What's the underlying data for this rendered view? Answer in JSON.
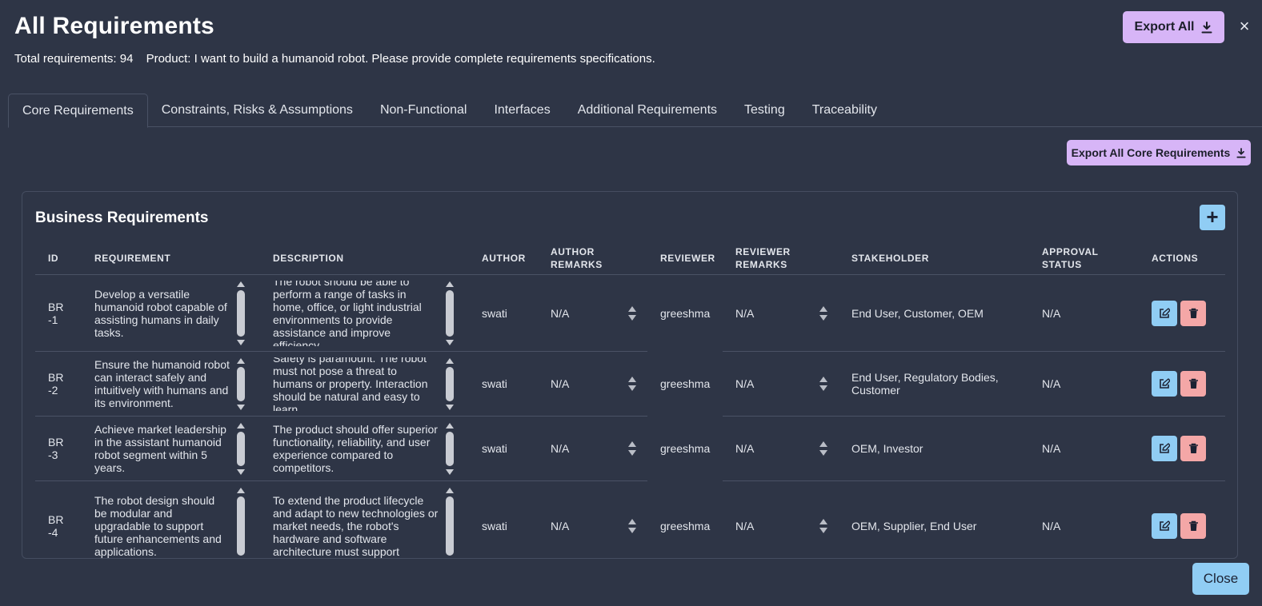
{
  "header": {
    "title": "All Requirements",
    "total_label": "Total requirements: 94",
    "product_label": "Product: I want to build a humanoid robot. Please provide complete requirements specifications.",
    "export_all_label": "Export All",
    "close_icon": "×"
  },
  "tabs": [
    {
      "label": "Core Requirements",
      "active": true
    },
    {
      "label": "Constraints, Risks & Assumptions"
    },
    {
      "label": "Non-Functional"
    },
    {
      "label": "Interfaces"
    },
    {
      "label": "Additional Requirements"
    },
    {
      "label": "Testing"
    },
    {
      "label": "Traceability"
    }
  ],
  "export_core_label": "Export All Core Requirements",
  "section": {
    "title": "Business Requirements",
    "add_icon": "+",
    "columns": [
      "ID",
      "REQUIREMENT",
      "DESCRIPTION",
      "AUTHOR",
      "AUTHOR REMARKS",
      "REVIEWER",
      "REVIEWER REMARKS",
      "STAKEHOLDER",
      "APPROVAL STATUS",
      "ACTIONS"
    ],
    "rows": [
      {
        "id": "BR-1",
        "requirement": "Develop a versatile humanoid robot capable of assisting humans in daily tasks.",
        "description": "The robot should be able to perform a range of tasks in home, office, or light industrial environments to provide assistance and improve efficiency.",
        "author": "swati",
        "author_remarks": "N/A",
        "reviewer": "greeshma",
        "reviewer_remarks": "N/A",
        "stakeholder": "End User, Customer, OEM",
        "approval_status": "N/A"
      },
      {
        "id": "BR-2",
        "requirement": "Ensure the humanoid robot can interact safely and intuitively with humans and its environment.",
        "description": "Safety is paramount. The robot must not pose a threat to humans or property. Interaction should be natural and easy to learn.",
        "author": "swati",
        "author_remarks": "N/A",
        "reviewer": "greeshma",
        "reviewer_remarks": "N/A",
        "stakeholder": "End User, Regulatory Bodies, Customer",
        "approval_status": "N/A"
      },
      {
        "id": "BR-3",
        "requirement": "Achieve market leadership in the assistant humanoid robot segment within 5 years.",
        "description": "The product should offer superior functionality, reliability, and user experience compared to competitors.",
        "author": "swati",
        "author_remarks": "N/A",
        "reviewer": "greeshma",
        "reviewer_remarks": "N/A",
        "stakeholder": "OEM, Investor",
        "approval_status": "N/A"
      },
      {
        "id": "BR-4",
        "requirement": "The robot design should be modular and upgradable to support future enhancements and applications.",
        "description": "To extend the product lifecycle and adapt to new technologies or market needs, the robot's hardware and software architecture must support",
        "author": "swati",
        "author_remarks": "N/A",
        "reviewer": "greeshma",
        "reviewer_remarks": "N/A",
        "stakeholder": "OEM, Supplier, End User",
        "approval_status": "N/A"
      }
    ]
  },
  "footer": {
    "close_label": "Close"
  }
}
